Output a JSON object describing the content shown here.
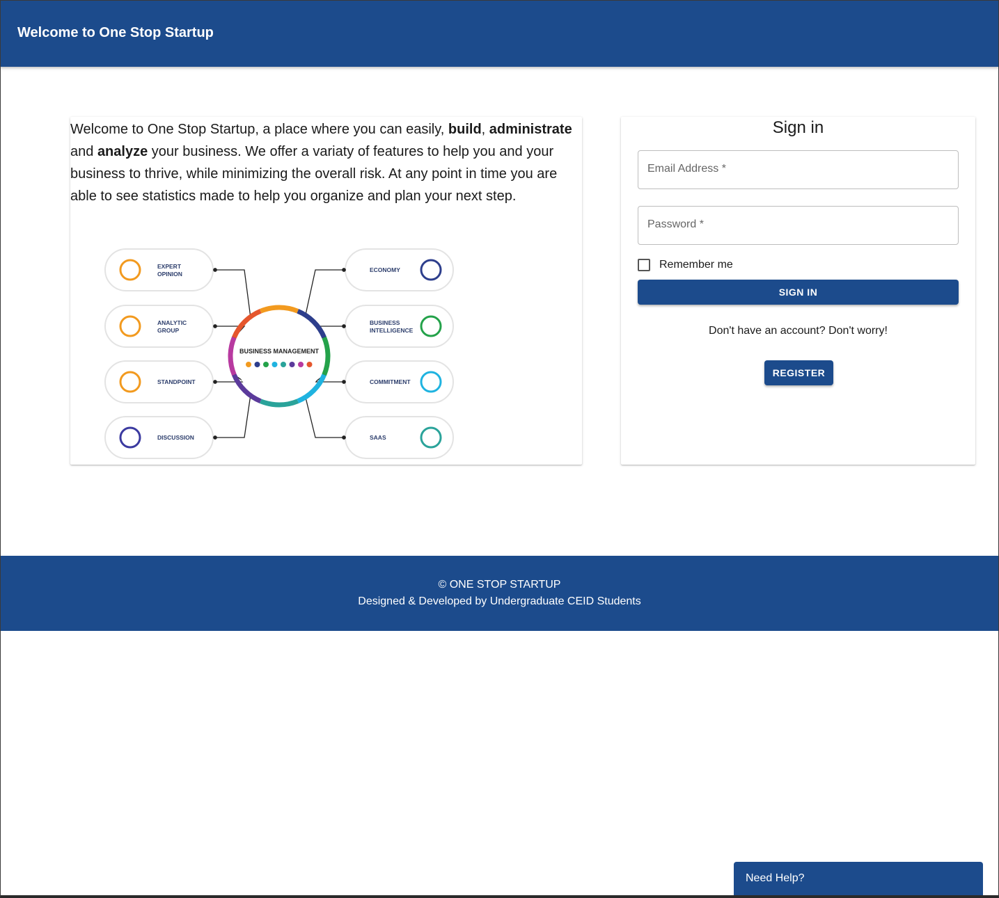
{
  "header": {
    "title": "Welcome to One Stop Startup"
  },
  "about": {
    "p1": "Welcome to One Stop Startup, a place where you can easily, ",
    "b1": "build",
    "p2": ", ",
    "b2": "administrate",
    "p3": " and ",
    "b3": "analyze",
    "p4": " your business. We offer a variaty of features to help you and your business to thrive, while minimizing the overall risk. At any point in time you are able to see statistics made to help you organize and plan your next step."
  },
  "diagram": {
    "center": "BUSINESS MANAGEMENT",
    "left_items": [
      {
        "line1": "EXPERT",
        "line2": "OPINION",
        "icon": "expert-icon"
      },
      {
        "line1": "ANALYTIC",
        "line2": "GROUP",
        "icon": "group-icon"
      },
      {
        "line1": "STANDPOINT",
        "line2": "",
        "icon": "checklist-icon"
      },
      {
        "line1": "DISCUSSION",
        "line2": "",
        "icon": "discussion-icon"
      }
    ],
    "right_items": [
      {
        "line1": "ECONOMY",
        "line2": "",
        "icon": "dollar-icon"
      },
      {
        "line1": "BUSINESS",
        "line2": "INTELLIGENCE",
        "icon": "network-icon"
      },
      {
        "line1": "COMMITMENT",
        "line2": "",
        "icon": "hands-icon"
      },
      {
        "line1": "SAAS",
        "line2": "",
        "icon": "cloud-icon"
      }
    ],
    "ring_colors": [
      "#f29a1f",
      "#2d3e8c",
      "#24a24a",
      "#1fb3e0",
      "#2aa39a",
      "#5b3a9b",
      "#b83aa0",
      "#e5562d"
    ]
  },
  "signin": {
    "title": "Sign in",
    "email_label": "Email Address *",
    "password_label": "Password *",
    "remember_label": "Remember me",
    "signin_button": "SIGN IN",
    "no_account_text": "Don't have an account? Don't worry!",
    "register_button": "REGISTER"
  },
  "footer": {
    "copyright": "© ONE STOP STARTUP",
    "credits": "Designed & Developed by Undergraduate CEID Students"
  },
  "help": {
    "label": "Need Help?"
  },
  "colors": {
    "primary": "#1c4b8c"
  }
}
